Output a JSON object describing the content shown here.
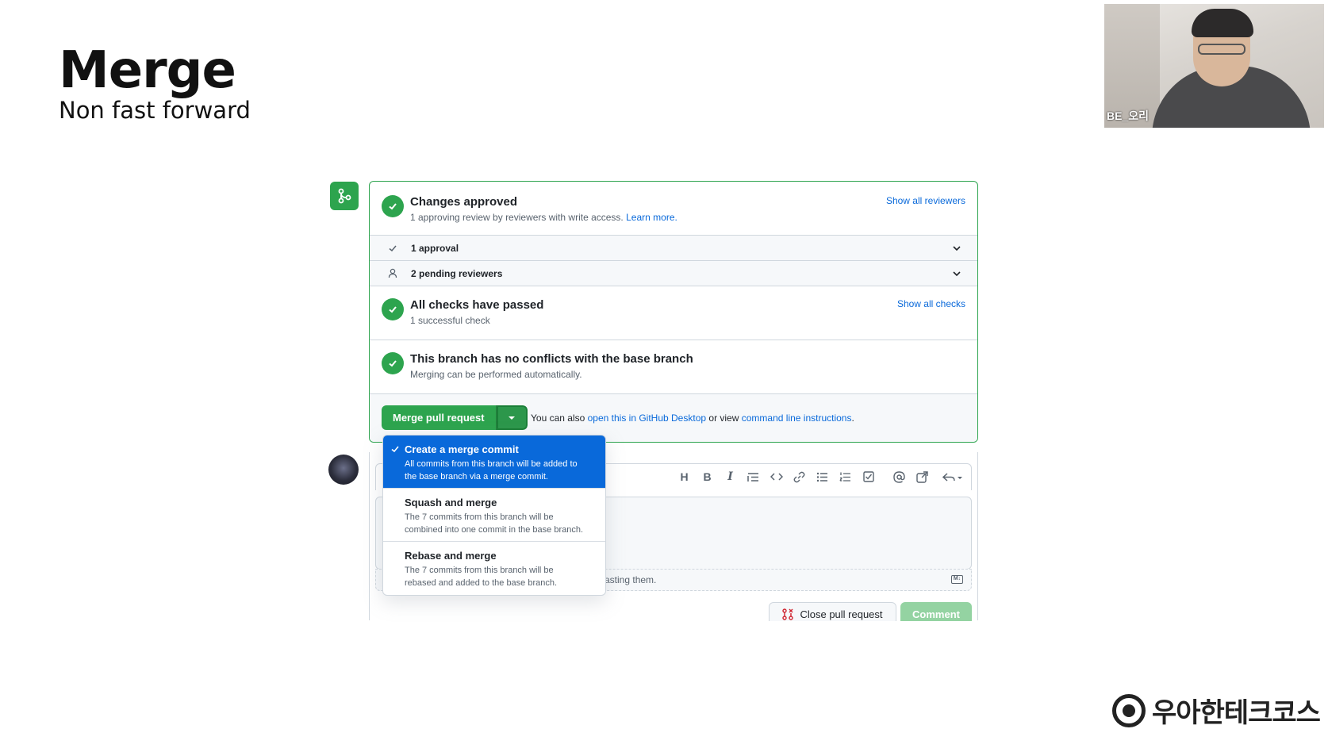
{
  "slide": {
    "title": "Merge",
    "subtitle": "Non fast forward"
  },
  "webcam": {
    "name": "BE_오리"
  },
  "brand": {
    "text": "우아한테크코스",
    "icon": "woowa-logo-icon"
  },
  "mergebox": {
    "approved": {
      "heading": "Changes approved",
      "sub_text": "1 approving review by reviewers with write access.",
      "learn_more": "Learn more.",
      "show_all": "Show all reviewers"
    },
    "approval_row": {
      "label": "1 approval",
      "icon": "check-icon"
    },
    "pending_row": {
      "label": "2 pending reviewers",
      "icon": "person-icon"
    },
    "checks": {
      "heading": "All checks have passed",
      "sub_text": "1 successful check",
      "show_all": "Show all checks"
    },
    "conflicts": {
      "heading": "This branch has no conflicts with the base branch",
      "sub_text": "Merging can be performed automatically."
    },
    "action": {
      "merge_button": "Merge pull request",
      "also_prefix": "You can also",
      "desktop_link": "open this in GitHub Desktop",
      "or_view": "or view",
      "cli_link": "command line instructions",
      "period": "."
    }
  },
  "dropdown": {
    "items": [
      {
        "title": "Create a merge commit",
        "desc1": "All commits from this branch will be added to",
        "desc2": "the base branch via a merge commit.",
        "selected": true
      },
      {
        "title": "Squash and merge",
        "desc1": "The 7 commits from this branch will be",
        "desc2": "combined into one commit in the base branch.",
        "selected": false
      },
      {
        "title": "Rebase and merge",
        "desc1": "The 7 commits from this branch will be",
        "desc2": "rebased and added to the base branch.",
        "selected": false
      }
    ]
  },
  "comment": {
    "attach_text": "asting them.",
    "toolbar_icons": [
      "heading-icon",
      "bold-icon",
      "italic-icon",
      "quote-icon",
      "code-icon",
      "link-icon",
      "unordered-list-icon",
      "ordered-list-icon",
      "task-list-icon",
      "mention-icon",
      "reference-icon",
      "reply-icon"
    ],
    "heading_glyph": "H",
    "bold_glyph": "B",
    "italic_glyph": "I",
    "close_button": "Close pull request",
    "comment_button": "Comment"
  },
  "colors": {
    "green": "#2da44e",
    "blue_link": "#0969da",
    "selected_bg": "#0969da"
  }
}
